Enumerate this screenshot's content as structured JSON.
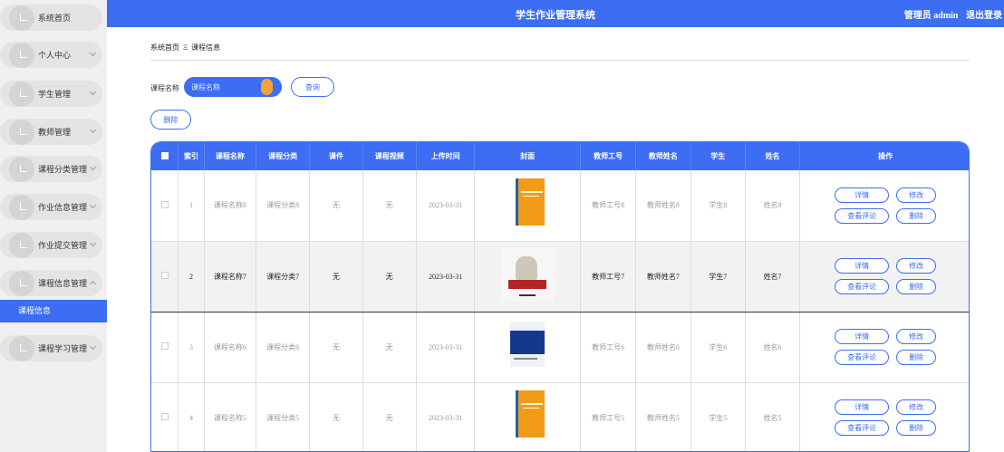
{
  "app": {
    "title": "学生作业管理系统"
  },
  "header": {
    "user_label": "管理员 admin",
    "logout": "退出登录"
  },
  "sidebar": {
    "items": [
      {
        "label": "系统首页",
        "has_chevron": false,
        "expanded": false
      },
      {
        "label": "个人中心",
        "has_chevron": true,
        "expanded": false
      },
      {
        "label": "学生管理",
        "has_chevron": true,
        "expanded": false
      },
      {
        "label": "教师管理",
        "has_chevron": true,
        "expanded": false
      },
      {
        "label": "课程分类管理",
        "has_chevron": true,
        "expanded": false
      },
      {
        "label": "作业信息管理",
        "has_chevron": true,
        "expanded": false
      },
      {
        "label": "作业提交管理",
        "has_chevron": true,
        "expanded": false
      },
      {
        "label": "课程信息管理",
        "has_chevron": true,
        "expanded": true
      },
      {
        "label": "课程学习管理",
        "has_chevron": true,
        "expanded": false
      }
    ],
    "active_sub": "课程信息"
  },
  "breadcrumb": {
    "home": "系统首页",
    "sep": "Ξ",
    "current": "课程信息"
  },
  "search": {
    "label": "课程名称",
    "placeholder": "课程名称",
    "button": "查询"
  },
  "toolbar": {
    "delete": "删除"
  },
  "table": {
    "headers": [
      "索引",
      "课程名称",
      "课程分类",
      "课件",
      "课程视频",
      "上传时间",
      "封面",
      "教师工号",
      "教师姓名",
      "学生",
      "姓名",
      "操作"
    ],
    "actions": {
      "detail": "详情",
      "edit": "修改",
      "comments": "查看评论",
      "delete": "删除"
    },
    "rows": [
      {
        "index": "1",
        "course": "课程名称8",
        "category": "课程分类8",
        "courseware": "无",
        "video": "无",
        "date": "2023-03-31",
        "cover": "orange",
        "teacher_no": "教师工号8",
        "teacher_name": "教师姓名8",
        "student": "学生8",
        "name": "姓名8",
        "highlighted": false
      },
      {
        "index": "2",
        "course": "课程名称7",
        "category": "课程分类7",
        "courseware": "无",
        "video": "无",
        "date": "2023-03-31",
        "cover": "light",
        "teacher_no": "教师工号7",
        "teacher_name": "教师姓名7",
        "student": "学生7",
        "name": "姓名7",
        "highlighted": true
      },
      {
        "index": "3",
        "course": "课程名称6",
        "category": "课程分类6",
        "courseware": "无",
        "video": "无",
        "date": "2023-03-31",
        "cover": "blue",
        "teacher_no": "教师工号6",
        "teacher_name": "教师姓名6",
        "student": "学生6",
        "name": "姓名6",
        "highlighted": false
      },
      {
        "index": "4",
        "course": "课程名称5",
        "category": "课程分类5",
        "courseware": "无",
        "video": "无",
        "date": "2023-03-31",
        "cover": "orange",
        "teacher_no": "教师工号5",
        "teacher_name": "教师姓名5",
        "student": "学生5",
        "name": "姓名5",
        "highlighted": false
      }
    ]
  },
  "colors": {
    "primary": "#3d6df2",
    "knob": "#f4a23a"
  }
}
